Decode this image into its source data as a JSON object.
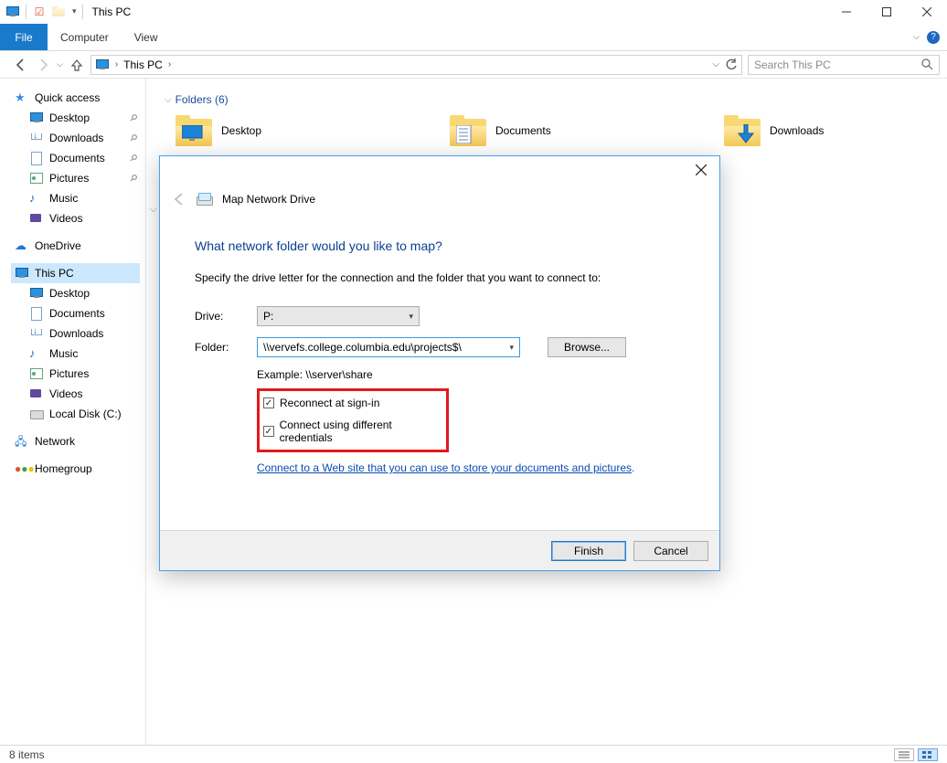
{
  "window": {
    "title": "This PC",
    "minimize_tooltip": "Minimize",
    "maximize_tooltip": "Maximize",
    "close_tooltip": "Close"
  },
  "ribbon": {
    "file": "File",
    "computer": "Computer",
    "view": "View"
  },
  "addressbar": {
    "location": "This PC",
    "search_placeholder": "Search This PC"
  },
  "sidebar": {
    "quick_access": "Quick access",
    "desktop": "Desktop",
    "downloads": "Downloads",
    "documents": "Documents",
    "pictures": "Pictures",
    "music": "Music",
    "videos": "Videos",
    "onedrive": "OneDrive",
    "this_pc": "This PC",
    "pc_desktop": "Desktop",
    "pc_documents": "Documents",
    "pc_downloads": "Downloads",
    "pc_music": "Music",
    "pc_pictures": "Pictures",
    "pc_videos": "Videos",
    "local_disk": "Local Disk (C:)",
    "network": "Network",
    "homegroup": "Homegroup"
  },
  "main": {
    "folders_header": "Folders (6)",
    "items": {
      "desktop": "Desktop",
      "documents": "Documents",
      "downloads": "Downloads"
    }
  },
  "statusbar": {
    "item_count": "8 items"
  },
  "dialog": {
    "title": "Map Network Drive",
    "heading": "What network folder would you like to map?",
    "subheading": "Specify the drive letter for the connection and the folder that you want to connect to:",
    "drive_label": "Drive:",
    "drive_value": "P:",
    "folder_label": "Folder:",
    "folder_value": "\\\\vervefs.college.columbia.edu\\projects$\\",
    "browse": "Browse...",
    "example": "Example: \\\\server\\share",
    "reconnect": "Reconnect at sign-in",
    "diff_credentials": "Connect using different credentials",
    "link_text": "Connect to a Web site that you can use to store your documents and pictures",
    "finish": "Finish",
    "cancel": "Cancel"
  }
}
